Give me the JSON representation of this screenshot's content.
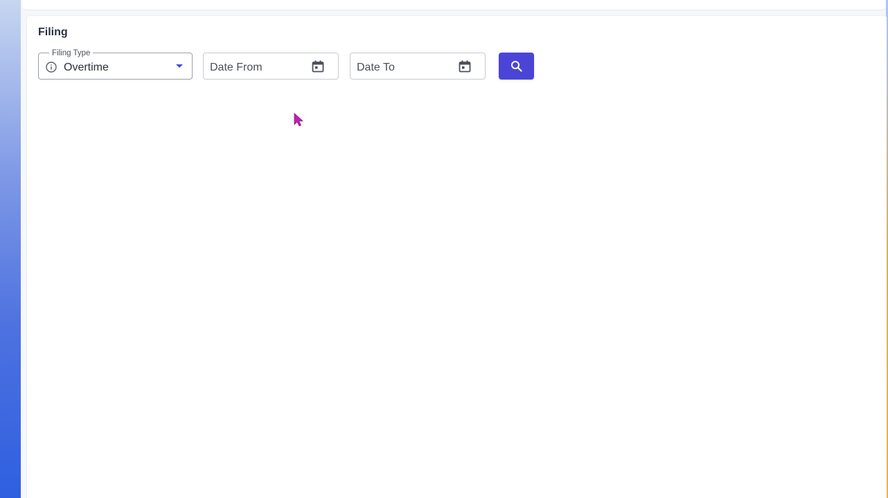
{
  "filing": {
    "title": "Filing",
    "filing_type": {
      "label": "Filing Type",
      "value": "Overtime",
      "icon": "info-icon"
    },
    "date_from": {
      "placeholder": "Date From",
      "icon": "calendar-icon"
    },
    "date_to": {
      "placeholder": "Date To",
      "icon": "calendar-icon"
    },
    "search_button": {
      "icon": "search-icon"
    }
  },
  "colors": {
    "accent": "#4a45d6",
    "cursor": "#c21fb0"
  }
}
